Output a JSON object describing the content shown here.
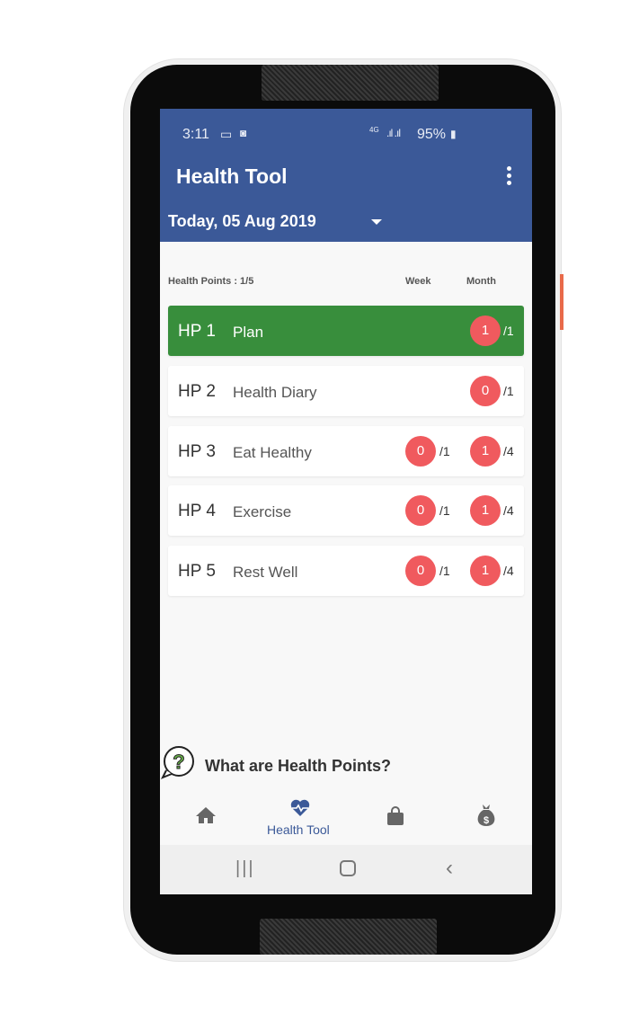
{
  "status_bar": {
    "time": "3:11",
    "network": "4G",
    "battery": "95%"
  },
  "app_bar": {
    "title": "Health Tool",
    "date": "Today, 05 Aug 2019"
  },
  "summary": {
    "label": "Health Points : 1/5",
    "week_header": "Week",
    "month_header": "Month"
  },
  "rows": [
    {
      "code": "HP 1",
      "name": "Plan",
      "week": null,
      "week_total": null,
      "month": "1",
      "month_total": "/1",
      "active": true
    },
    {
      "code": "HP 2",
      "name": "Health Diary",
      "week": null,
      "week_total": null,
      "month": "0",
      "month_total": "/1"
    },
    {
      "code": "HP 3",
      "name": "Eat Healthy",
      "week": "0",
      "week_total": "/1",
      "month": "1",
      "month_total": "/4"
    },
    {
      "code": "HP 4",
      "name": "Exercise",
      "week": "0",
      "week_total": "/1",
      "month": "1",
      "month_total": "/4"
    },
    {
      "code": "HP 5",
      "name": "Rest Well",
      "week": "0",
      "week_total": "/1",
      "month": "1",
      "month_total": "/4"
    }
  ],
  "help": {
    "label": "What are Health Points?"
  },
  "bottom_nav": {
    "items": [
      {
        "icon": "home-icon"
      },
      {
        "icon": "heart-pulse-icon",
        "label": "Health Tool",
        "active": true
      },
      {
        "icon": "bag-icon"
      },
      {
        "icon": "money-bag-icon"
      }
    ]
  },
  "colors": {
    "primary": "#3b5998",
    "active_row": "#388e3c",
    "badge": "#f05a5e"
  }
}
